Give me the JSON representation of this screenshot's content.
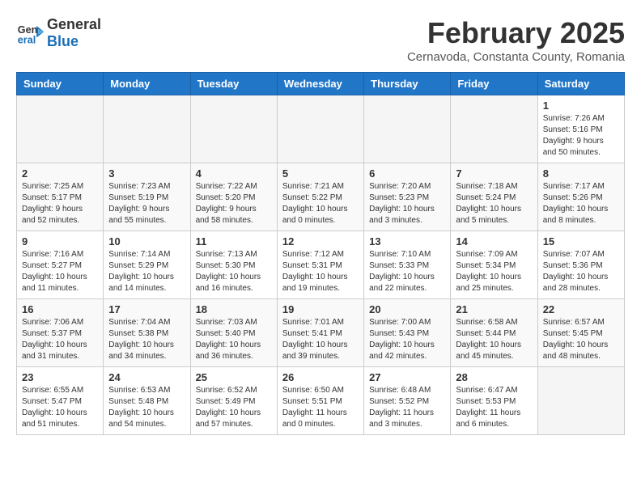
{
  "header": {
    "logo_line1": "General",
    "logo_line2": "Blue",
    "title": "February 2025",
    "subtitle": "Cernavoda, Constanta County, Romania"
  },
  "columns": [
    "Sunday",
    "Monday",
    "Tuesday",
    "Wednesday",
    "Thursday",
    "Friday",
    "Saturday"
  ],
  "weeks": [
    [
      {
        "day": "",
        "info": ""
      },
      {
        "day": "",
        "info": ""
      },
      {
        "day": "",
        "info": ""
      },
      {
        "day": "",
        "info": ""
      },
      {
        "day": "",
        "info": ""
      },
      {
        "day": "",
        "info": ""
      },
      {
        "day": "1",
        "info": "Sunrise: 7:26 AM\nSunset: 5:16 PM\nDaylight: 9 hours\nand 50 minutes."
      }
    ],
    [
      {
        "day": "2",
        "info": "Sunrise: 7:25 AM\nSunset: 5:17 PM\nDaylight: 9 hours\nand 52 minutes."
      },
      {
        "day": "3",
        "info": "Sunrise: 7:23 AM\nSunset: 5:19 PM\nDaylight: 9 hours\nand 55 minutes."
      },
      {
        "day": "4",
        "info": "Sunrise: 7:22 AM\nSunset: 5:20 PM\nDaylight: 9 hours\nand 58 minutes."
      },
      {
        "day": "5",
        "info": "Sunrise: 7:21 AM\nSunset: 5:22 PM\nDaylight: 10 hours\nand 0 minutes."
      },
      {
        "day": "6",
        "info": "Sunrise: 7:20 AM\nSunset: 5:23 PM\nDaylight: 10 hours\nand 3 minutes."
      },
      {
        "day": "7",
        "info": "Sunrise: 7:18 AM\nSunset: 5:24 PM\nDaylight: 10 hours\nand 5 minutes."
      },
      {
        "day": "8",
        "info": "Sunrise: 7:17 AM\nSunset: 5:26 PM\nDaylight: 10 hours\nand 8 minutes."
      }
    ],
    [
      {
        "day": "9",
        "info": "Sunrise: 7:16 AM\nSunset: 5:27 PM\nDaylight: 10 hours\nand 11 minutes."
      },
      {
        "day": "10",
        "info": "Sunrise: 7:14 AM\nSunset: 5:29 PM\nDaylight: 10 hours\nand 14 minutes."
      },
      {
        "day": "11",
        "info": "Sunrise: 7:13 AM\nSunset: 5:30 PM\nDaylight: 10 hours\nand 16 minutes."
      },
      {
        "day": "12",
        "info": "Sunrise: 7:12 AM\nSunset: 5:31 PM\nDaylight: 10 hours\nand 19 minutes."
      },
      {
        "day": "13",
        "info": "Sunrise: 7:10 AM\nSunset: 5:33 PM\nDaylight: 10 hours\nand 22 minutes."
      },
      {
        "day": "14",
        "info": "Sunrise: 7:09 AM\nSunset: 5:34 PM\nDaylight: 10 hours\nand 25 minutes."
      },
      {
        "day": "15",
        "info": "Sunrise: 7:07 AM\nSunset: 5:36 PM\nDaylight: 10 hours\nand 28 minutes."
      }
    ],
    [
      {
        "day": "16",
        "info": "Sunrise: 7:06 AM\nSunset: 5:37 PM\nDaylight: 10 hours\nand 31 minutes."
      },
      {
        "day": "17",
        "info": "Sunrise: 7:04 AM\nSunset: 5:38 PM\nDaylight: 10 hours\nand 34 minutes."
      },
      {
        "day": "18",
        "info": "Sunrise: 7:03 AM\nSunset: 5:40 PM\nDaylight: 10 hours\nand 36 minutes."
      },
      {
        "day": "19",
        "info": "Sunrise: 7:01 AM\nSunset: 5:41 PM\nDaylight: 10 hours\nand 39 minutes."
      },
      {
        "day": "20",
        "info": "Sunrise: 7:00 AM\nSunset: 5:43 PM\nDaylight: 10 hours\nand 42 minutes."
      },
      {
        "day": "21",
        "info": "Sunrise: 6:58 AM\nSunset: 5:44 PM\nDaylight: 10 hours\nand 45 minutes."
      },
      {
        "day": "22",
        "info": "Sunrise: 6:57 AM\nSunset: 5:45 PM\nDaylight: 10 hours\nand 48 minutes."
      }
    ],
    [
      {
        "day": "23",
        "info": "Sunrise: 6:55 AM\nSunset: 5:47 PM\nDaylight: 10 hours\nand 51 minutes."
      },
      {
        "day": "24",
        "info": "Sunrise: 6:53 AM\nSunset: 5:48 PM\nDaylight: 10 hours\nand 54 minutes."
      },
      {
        "day": "25",
        "info": "Sunrise: 6:52 AM\nSunset: 5:49 PM\nDaylight: 10 hours\nand 57 minutes."
      },
      {
        "day": "26",
        "info": "Sunrise: 6:50 AM\nSunset: 5:51 PM\nDaylight: 11 hours\nand 0 minutes."
      },
      {
        "day": "27",
        "info": "Sunrise: 6:48 AM\nSunset: 5:52 PM\nDaylight: 11 hours\nand 3 minutes."
      },
      {
        "day": "28",
        "info": "Sunrise: 6:47 AM\nSunset: 5:53 PM\nDaylight: 11 hours\nand 6 minutes."
      },
      {
        "day": "",
        "info": ""
      }
    ]
  ]
}
